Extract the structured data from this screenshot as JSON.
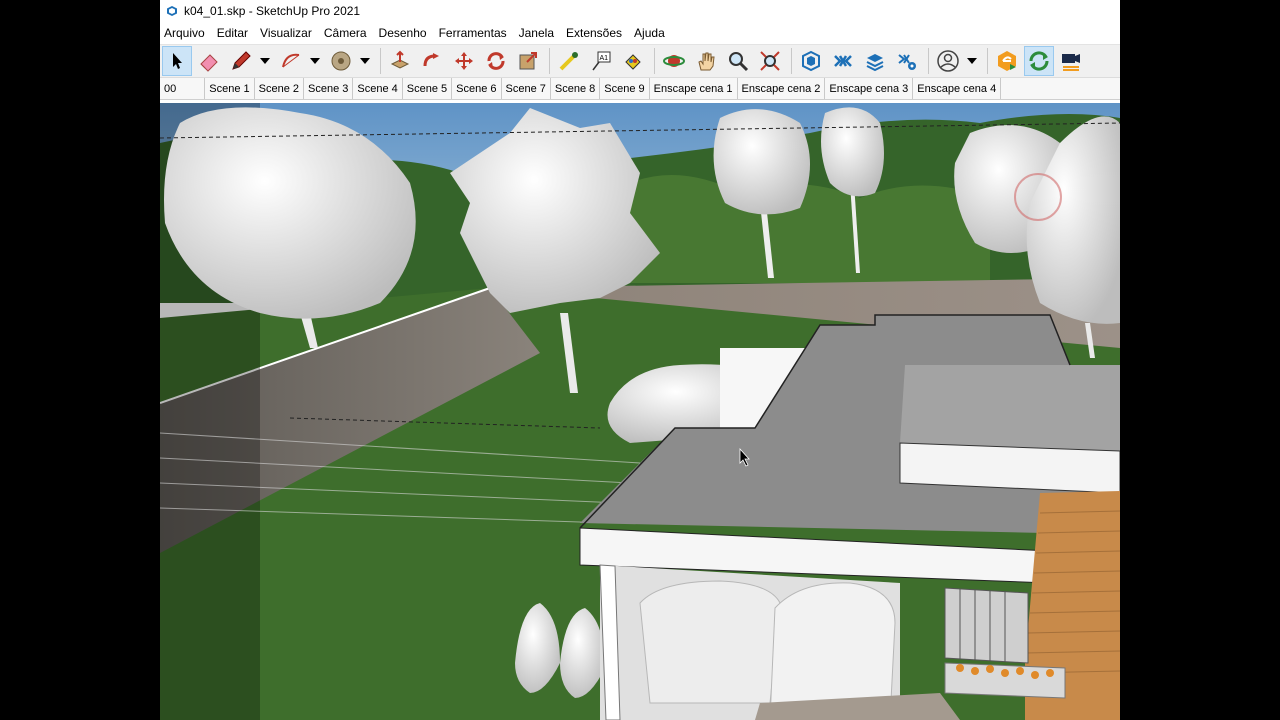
{
  "window": {
    "title": "k04_01.skp - SketchUp Pro 2021"
  },
  "menu": [
    "Arquivo",
    "Editar",
    "Visualizar",
    "Câmera",
    "Desenho",
    "Ferramentas",
    "Janela",
    "Extensões",
    "Ajuda"
  ],
  "toolbar": {
    "icons": [
      "select-icon",
      "eraser-icon",
      "pencil-icon",
      "arc-icon",
      "paint-bucket-icon",
      "push-pull-icon",
      "follow-me-icon",
      "move-icon",
      "rotate-icon",
      "scale-icon",
      "tape-measure-icon",
      "text-icon",
      "paint-icon",
      "orbit-icon",
      "pan-icon",
      "zoom-icon",
      "zoom-extents-icon",
      "warehouse-icon",
      "extension-warehouse-icon",
      "layout-icon",
      "extension-manager-icon",
      "account-icon",
      "enscape-start-icon",
      "enscape-sync-icon",
      "enscape-video-icon"
    ]
  },
  "scenes": [
    "00",
    "Scene 1",
    "Scene 2",
    "Scene 3",
    "Scene 4",
    "Scene 5",
    "Scene 6",
    "Scene 7",
    "Scene 8",
    "Scene 9",
    "Enscape cena 1",
    "Enscape cena 2",
    "Enscape cena 3",
    "Enscape cena 4"
  ],
  "colors": {
    "sky": "#6f9fc8",
    "grass": "#3e6e2c",
    "roof": "#8c8c8c",
    "wall": "#f4f4f4",
    "wood": "#c88a4a",
    "stone": "#8a7e74"
  }
}
